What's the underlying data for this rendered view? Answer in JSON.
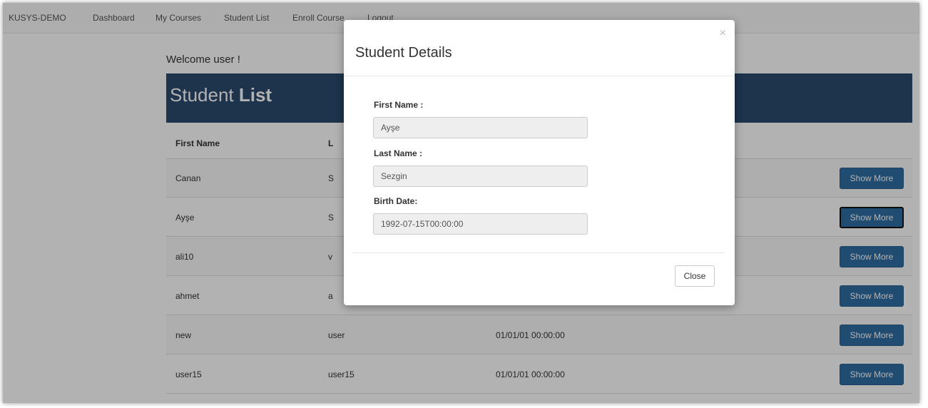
{
  "navbar": {
    "brand": "KUSYS-DEMO",
    "items": [
      "Dashboard",
      "My Courses",
      "Student List",
      "Enroll Course",
      "Logout"
    ]
  },
  "welcome": "Welcome user !",
  "list_header": {
    "title_light": "Student ",
    "title_bold": "List"
  },
  "table": {
    "columns": [
      "First Name",
      "L"
    ],
    "rows": [
      {
        "first": "Canan",
        "last": "S",
        "birth": "",
        "button": "Show More"
      },
      {
        "first": "Ayşe",
        "last": "S",
        "birth": "",
        "button": "Show More"
      },
      {
        "first": "ali10",
        "last": "v",
        "birth": "",
        "button": "Show More"
      },
      {
        "first": "ahmet",
        "last": "a",
        "birth": "",
        "button": "Show More"
      },
      {
        "first": "new",
        "last": "user",
        "birth": "01/01/01 00:00:00",
        "button": "Show More"
      },
      {
        "first": "user15",
        "last": "user15",
        "birth": "01/01/01 00:00:00",
        "button": "Show More"
      }
    ]
  },
  "modal": {
    "title": "Student Details",
    "close_icon": "×",
    "fields": [
      {
        "label": "First Name :",
        "value": "Ayşe"
      },
      {
        "label": "Last Name :",
        "value": "Sezgin"
      },
      {
        "label": "Birth Date:",
        "value": "1992-07-15T00:00:00"
      }
    ],
    "close_button": "Close"
  },
  "colors": {
    "header_bg": "#2c4a6e",
    "button_bg": "#2e6da4"
  }
}
